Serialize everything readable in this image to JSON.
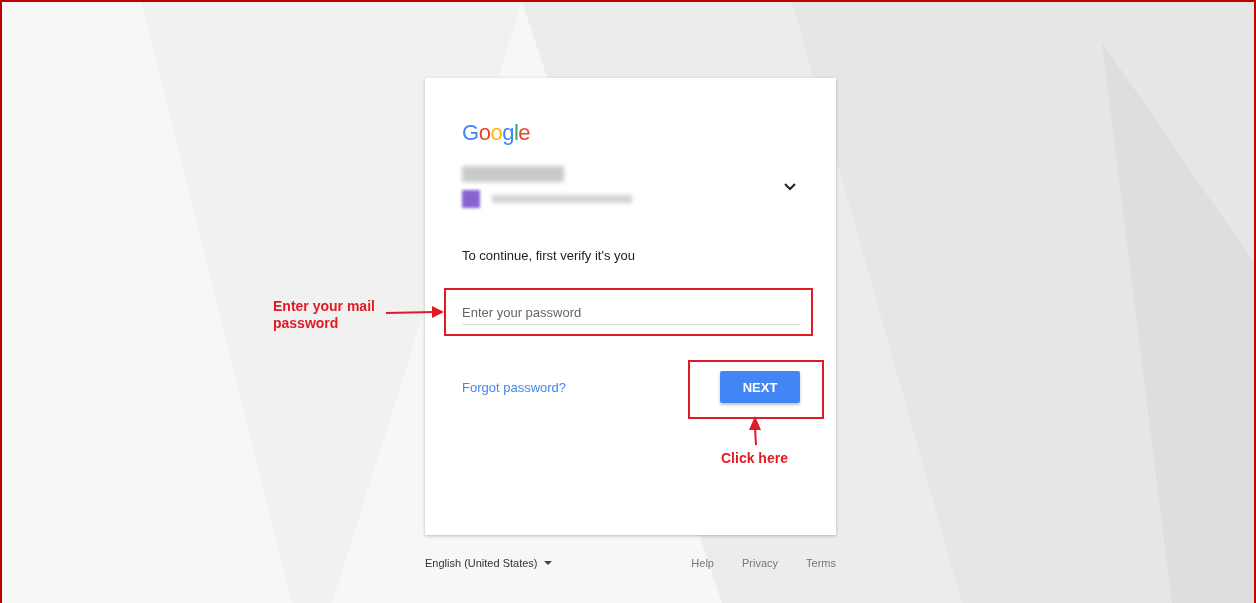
{
  "logo": "Google",
  "prompt": "To continue, first verify it's you",
  "password": {
    "placeholder": "Enter your password"
  },
  "forgot_link": "Forgot password?",
  "next_button": "NEXT",
  "footer": {
    "language": "English (United States)",
    "links": [
      "Help",
      "Privacy",
      "Terms"
    ]
  },
  "annotations": [
    {
      "kind": "field",
      "text": "Enter your mail password"
    },
    {
      "kind": "button",
      "text": "Click here"
    }
  ]
}
